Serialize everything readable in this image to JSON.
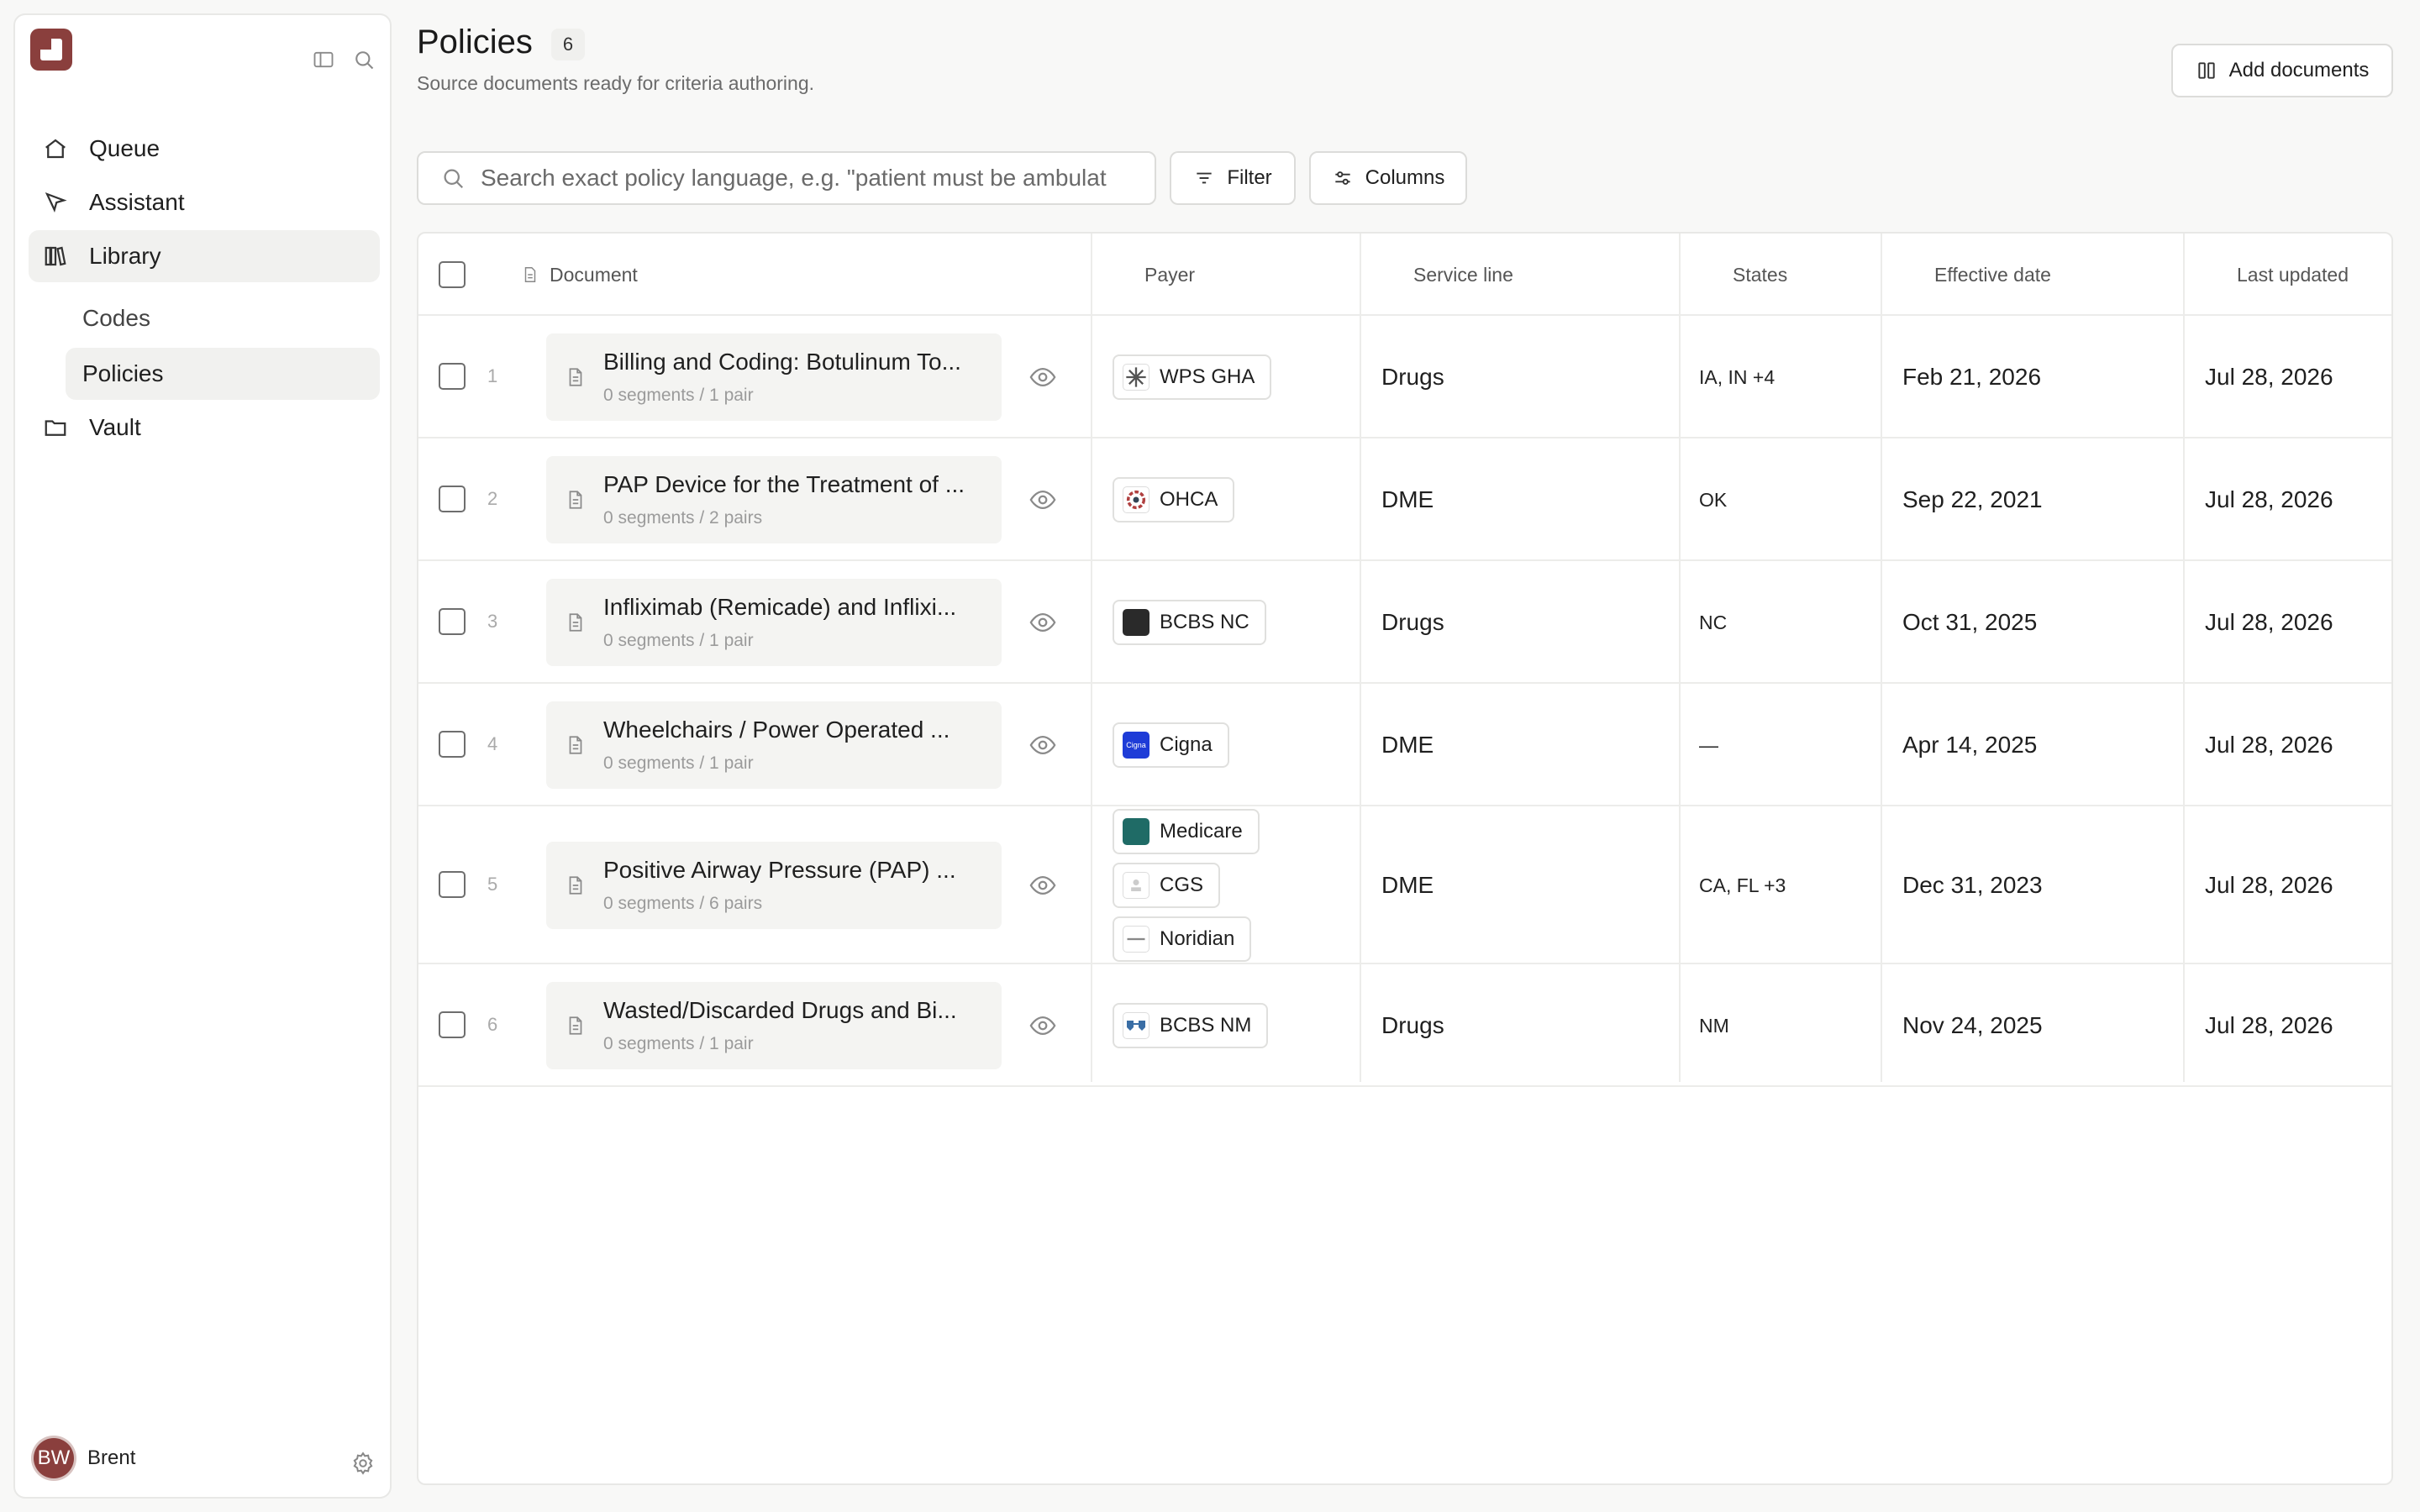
{
  "sidebar": {
    "nav": [
      {
        "label": "Queue",
        "icon": "home-icon"
      },
      {
        "label": "Assistant",
        "icon": "cursor-icon"
      },
      {
        "label": "Library",
        "icon": "library-icon"
      },
      {
        "label": "Vault",
        "icon": "folder-icon"
      }
    ],
    "sub": [
      {
        "label": "Codes"
      },
      {
        "label": "Policies"
      }
    ],
    "user": {
      "initials": "BW",
      "name": "Brent"
    }
  },
  "header": {
    "title": "Policies",
    "count": "6",
    "subtitle": "Source documents ready for criteria authoring.",
    "add_label": "Add documents"
  },
  "toolbar": {
    "search_placeholder": "Search exact policy language, e.g. \"patient must be ambulat",
    "filter_label": "Filter",
    "columns_label": "Columns"
  },
  "columns": {
    "document": "Document",
    "payer": "Payer",
    "service": "Service line",
    "states": "States",
    "effective": "Effective date",
    "updated": "Last updated"
  },
  "rows": [
    {
      "num": "1",
      "title": "Billing and Coding: Botulinum To...",
      "meta": "0 segments / 1 pair",
      "payers": [
        {
          "name": "WPS GHA",
          "color": "#ffffff",
          "mark": "wps"
        }
      ],
      "service": "Drugs",
      "states": "IA, IN +4",
      "effective": "Feb 21, 2026",
      "updated": "Jul 28, 2026"
    },
    {
      "num": "2",
      "title": "PAP Device for the Treatment of ...",
      "meta": "0 segments / 2 pairs",
      "payers": [
        {
          "name": "OHCA",
          "color": "#ffffff",
          "mark": "ohca"
        }
      ],
      "service": "DME",
      "states": "OK",
      "effective": "Sep 22, 2021",
      "updated": "Jul 28, 2026"
    },
    {
      "num": "3",
      "title": "Infliximab (Remicade) and Inflixi...",
      "meta": "0 segments / 1 pair",
      "payers": [
        {
          "name": "BCBS NC",
          "color": "#2a2a2a",
          "mark": "dark"
        }
      ],
      "service": "Drugs",
      "states": "NC",
      "effective": "Oct 31, 2025",
      "updated": "Jul 28, 2026"
    },
    {
      "num": "4",
      "title": "Wheelchairs / Power Operated ...",
      "meta": "0 segments / 1 pair",
      "payers": [
        {
          "name": "Cigna",
          "color": "#1e3cd7",
          "mark": "cigna"
        }
      ],
      "service": "DME",
      "states": "—",
      "effective": "Apr 14, 2025",
      "updated": "Jul 28, 2026"
    },
    {
      "num": "5",
      "title": "Positive Airway Pressure (PAP) ...",
      "meta": "0 segments / 6 pairs",
      "payers": [
        {
          "name": "Medicare",
          "color": "#1f6b66",
          "mark": "medicare"
        },
        {
          "name": "CGS",
          "color": "#ffffff",
          "mark": "cgs"
        },
        {
          "name": "Noridian",
          "color": "#ffffff",
          "mark": "noridian"
        }
      ],
      "service": "DME",
      "states": "CA, FL +3",
      "effective": "Dec 31, 2023",
      "updated": "Jul 28, 2026"
    },
    {
      "num": "6",
      "title": "Wasted/Discarded Drugs and Bi...",
      "meta": "0 segments / 1 pair",
      "payers": [
        {
          "name": "BCBS NM",
          "color": "#ffffff",
          "mark": "bcbsnm"
        }
      ],
      "service": "Drugs",
      "states": "NM",
      "effective": "Nov 24, 2025",
      "updated": "Jul 28, 2026"
    }
  ]
}
